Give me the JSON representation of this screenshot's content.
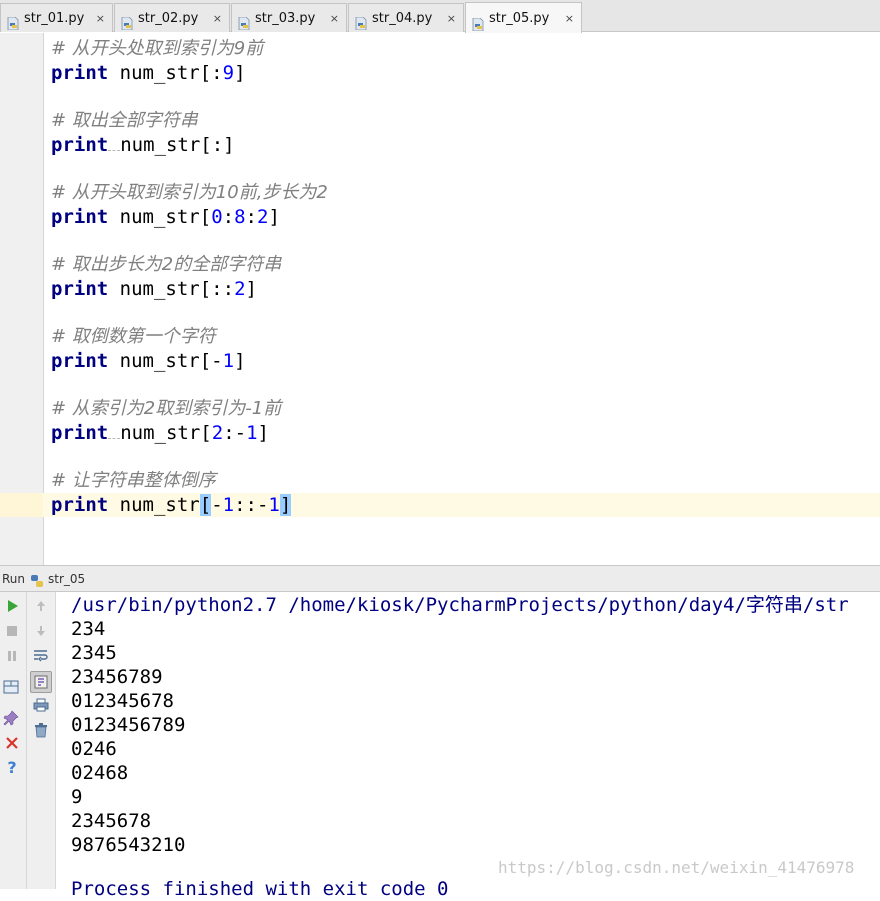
{
  "tabs": [
    {
      "label": "str_01.py",
      "close": "×",
      "active": false
    },
    {
      "label": "str_02.py",
      "close": "×",
      "active": false
    },
    {
      "label": "str_03.py",
      "close": "×",
      "active": false
    },
    {
      "label": "str_04.py",
      "close": "×",
      "active": false
    },
    {
      "label": "str_05.py",
      "close": "×",
      "active": true
    }
  ],
  "code": {
    "c1": "# 从开头处取到索引为9前",
    "c2": "# 取出全部字符串",
    "c3": "# 从开头取到索引为10前,步长为2",
    "c4": "# 取出步长为2的全部字符串",
    "c5": "# 取倒数第一个字符",
    "c6": "# 从索引为2取到索引为-1前",
    "c7": "# 让字符串整体倒序",
    "keyword": "print",
    "var": "num_str",
    "l1": {
      "open": "[:",
      "n1": "9",
      "close": "]"
    },
    "l2": {
      "args": "[:]"
    },
    "l3": {
      "open": "[",
      "n1": "0",
      "s1": ":",
      "n2": "8",
      "s2": ":",
      "n3": "2",
      "close": "]"
    },
    "l4": {
      "open": "[::",
      "n1": "2",
      "close": "]"
    },
    "l5": {
      "open": "[-",
      "n1": "1",
      "close": "]"
    },
    "l6": {
      "open": "[",
      "n1": "2",
      "s1": ":-",
      "n2": "1",
      "close": "]"
    },
    "l7": {
      "open": "[",
      "minus": "-",
      "n1": "1",
      "s1": "::-",
      "n2": "1",
      "close": "]"
    }
  },
  "run": {
    "label": "Run",
    "config": "str_05"
  },
  "output": {
    "command": "/usr/bin/python2.7 /home/kiosk/PycharmProjects/python/day4/字符串/str",
    "lines": [
      "234",
      "2345",
      "23456789",
      "012345678",
      "0123456789",
      "0246",
      "02468",
      "9",
      "2345678",
      "9876543210"
    ],
    "finished": "Process finished with exit code 0"
  },
  "watermark": "https://blog.csdn.net/weixin_41476978",
  "colors": {
    "keyword": "#000080",
    "number": "#0000ff",
    "comment": "#808080",
    "bracket_match": "#99ccff",
    "current_line": "#fffae3"
  }
}
